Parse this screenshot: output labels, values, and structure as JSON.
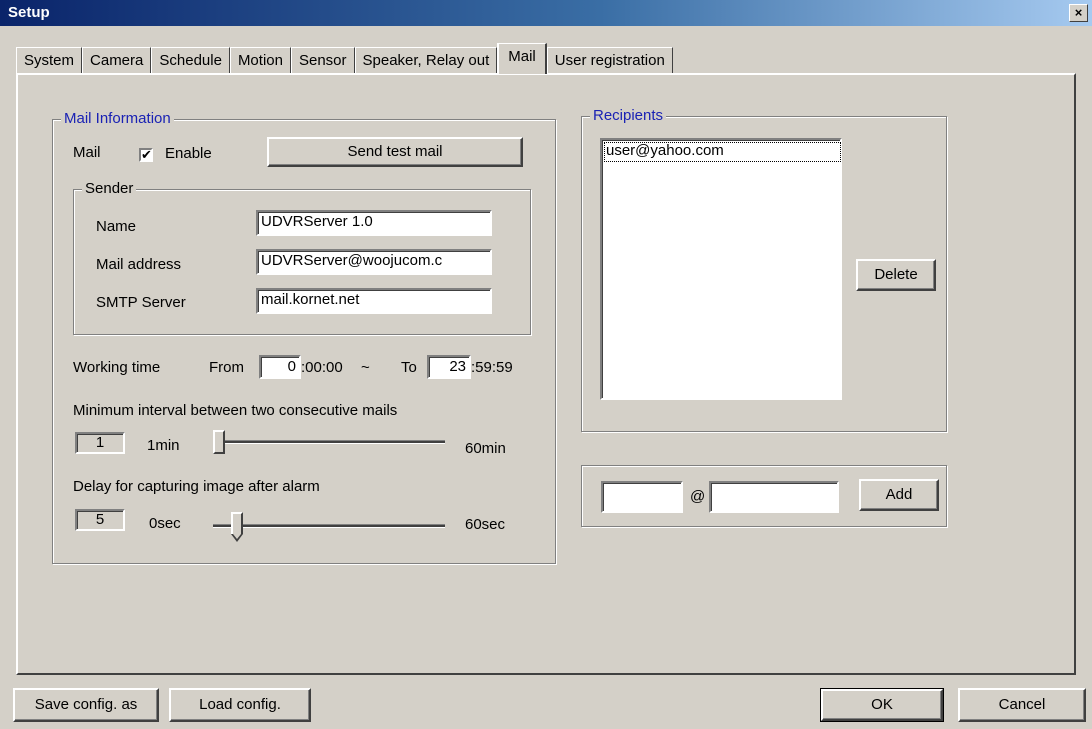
{
  "window": {
    "title": "Setup",
    "close_glyph": "×"
  },
  "tabs": [
    {
      "label": "System"
    },
    {
      "label": "Camera"
    },
    {
      "label": "Schedule"
    },
    {
      "label": "Motion"
    },
    {
      "label": "Sensor"
    },
    {
      "label": "Speaker, Relay out"
    },
    {
      "label": "Mail",
      "active": true
    },
    {
      "label": "User registration"
    }
  ],
  "mail_info": {
    "group_label": "Mail Information",
    "mail_label": "Mail",
    "enable_label": "Enable",
    "enable_checked": true,
    "enable_glyph": "✔",
    "send_test_label": "Send test mail",
    "sender": {
      "group_label": "Sender",
      "name_label": "Name",
      "name_value": "UDVRServer 1.0",
      "address_label": "Mail address",
      "address_value": "UDVRServer@woojucom.c",
      "smtp_label": "SMTP Server",
      "smtp_value": "mail.kornet.net"
    },
    "working_time": {
      "label": "Working time",
      "from_label": "From",
      "from_value": "0",
      "from_suffix": ":00:00",
      "tilde": "~",
      "to_label": "To",
      "to_value": "23",
      "to_suffix": ":59:59"
    },
    "interval": {
      "label": "Minimum interval between two consecutive mails",
      "value": "1",
      "min_label": "1min",
      "max_label": "60min",
      "slider_min": 1,
      "slider_max": 60,
      "slider_value": 1
    },
    "delay": {
      "label": "Delay for capturing image after alarm",
      "value": "5",
      "min_label": "0sec",
      "max_label": "60sec",
      "slider_min": 0,
      "slider_max": 60,
      "slider_value": 5
    }
  },
  "recipients": {
    "group_label": "Recipients",
    "items": [
      "user@yahoo.com"
    ],
    "delete_label": "Delete",
    "at_symbol": "@",
    "user_value": "",
    "domain_value": "",
    "add_label": "Add"
  },
  "footer": {
    "save_label": "Save config. as",
    "load_label": "Load config.",
    "ok_label": "OK",
    "cancel_label": "Cancel"
  }
}
